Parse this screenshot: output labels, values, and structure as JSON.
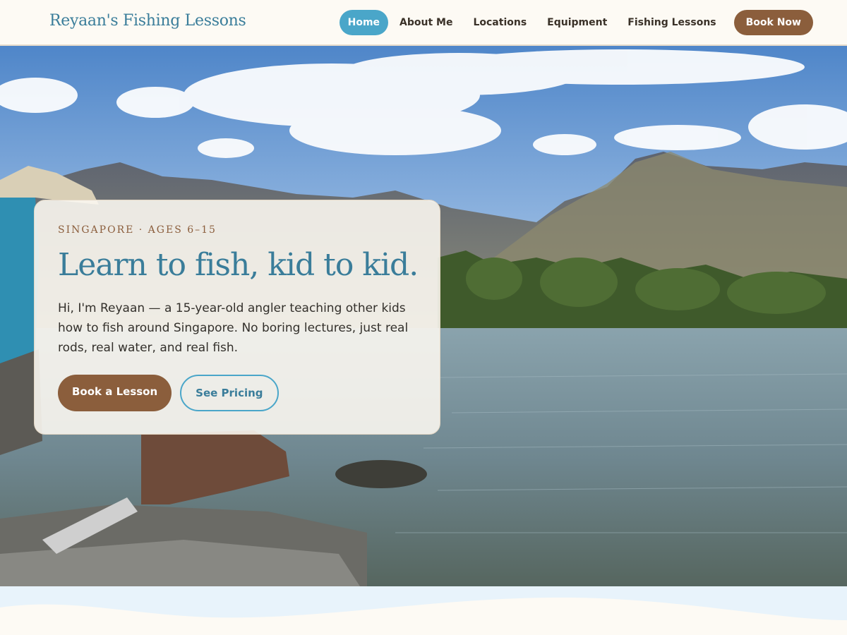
{
  "brand": "Reyaan's Fishing Lessons",
  "nav": {
    "items": [
      "Home",
      "About Me",
      "Locations",
      "Equipment",
      "Fishing Lessons"
    ],
    "active": "Home",
    "cta": "Book Now"
  },
  "hero": {
    "eyebrow": "SINGAPORE · AGES 6–15",
    "headline": "Learn to fish, kid to kid.",
    "lede": "Hi, I'm Reyaan — a 15-year-old angler teaching other kids how to fish around Singapore. No boring lectures, just real rods, real water, and real fish.",
    "primary_cta": "Book a Lesson",
    "secondary_cta": "See Pricing"
  },
  "colors": {
    "brand_blue": "#3a7d9a",
    "accent_blue": "#4aa6c9",
    "brown": "#8b5e3c",
    "cream": "#fdfaf4"
  }
}
